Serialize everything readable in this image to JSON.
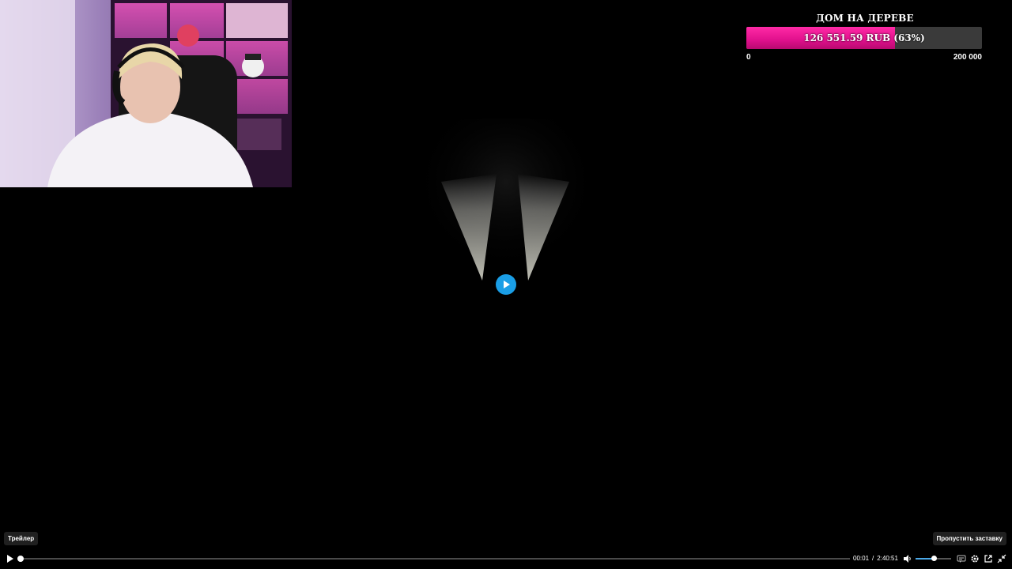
{
  "goal": {
    "title": "ДОМ НА ДЕРЕВЕ",
    "progress_text": "126 551.59 RUB (63%)",
    "progress_fraction": 0.63,
    "min_label": "0",
    "max_label": "200 000",
    "fill_color": "#e0108c"
  },
  "player": {
    "trailer_label": "Трейлер",
    "skip_label": "Пропустить заставку",
    "current_time": "00:01",
    "time_separator": "/",
    "duration": "2:40:51",
    "seek_fraction": 0.002,
    "volume_fraction": 0.5,
    "accent_color": "#1a9ee6",
    "icons": [
      "play-icon",
      "volume-icon",
      "subtitles-icon",
      "settings-icon",
      "popout-icon",
      "exit-fullscreen-icon"
    ]
  }
}
